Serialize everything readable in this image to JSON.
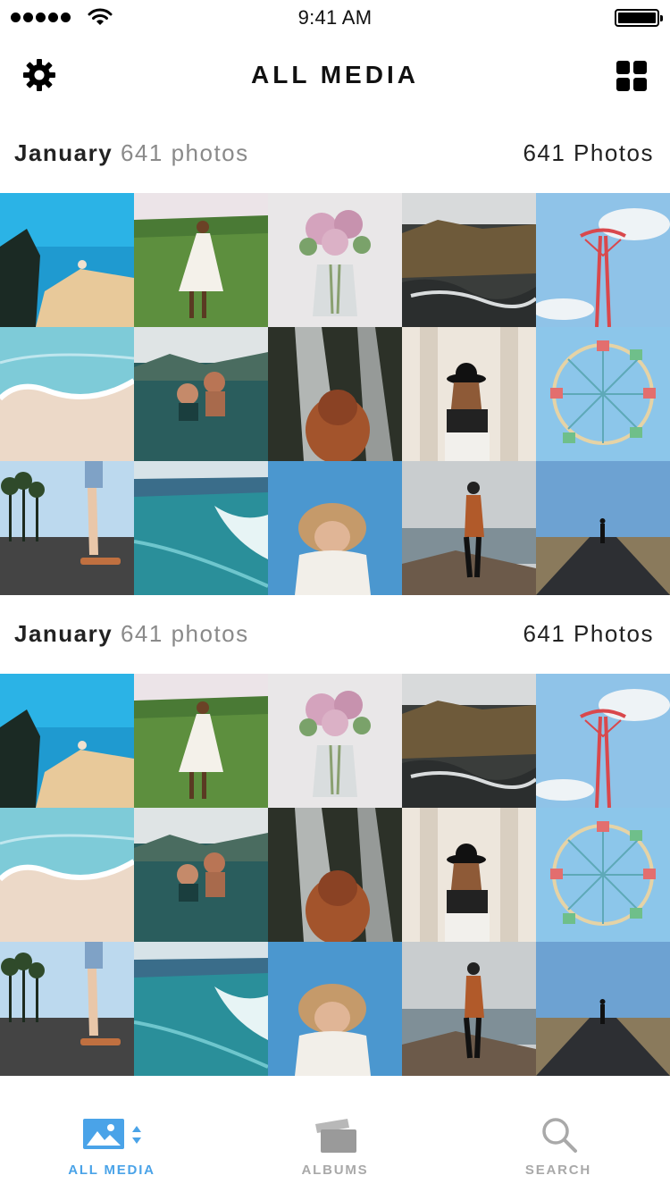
{
  "status_bar": {
    "time": "9:41 AM",
    "signal_icon": "signal-dots-icon",
    "wifi_icon": "wifi-icon",
    "battery_icon": "battery-icon"
  },
  "nav": {
    "title": "ALL MEDIA",
    "left_icon": "gear-icon",
    "right_icon": "grid-view-icon"
  },
  "sections": [
    {
      "month": "January",
      "count_label": "641 photos",
      "total_label": "641 Photos",
      "photos": [
        {
          "subject": "cliff-over-ocean"
        },
        {
          "subject": "girl-in-meadow"
        },
        {
          "subject": "rose-vase"
        },
        {
          "subject": "rocky-coast"
        },
        {
          "subject": "red-tower"
        },
        {
          "subject": "beach-waves"
        },
        {
          "subject": "snorkel-couple"
        },
        {
          "subject": "waterfall-girl"
        },
        {
          "subject": "girl-in-hat-hallway"
        },
        {
          "subject": "ferris-wheel"
        },
        {
          "subject": "skateboard-palms"
        },
        {
          "subject": "surf-ocean"
        },
        {
          "subject": "woman-straw-hat"
        },
        {
          "subject": "woman-on-rocks"
        },
        {
          "subject": "desert-road"
        }
      ]
    },
    {
      "month": "January",
      "count_label": "641 photos",
      "total_label": "641 Photos",
      "photos": [
        {
          "subject": "cliff-over-ocean"
        },
        {
          "subject": "girl-in-meadow"
        },
        {
          "subject": "rose-vase"
        },
        {
          "subject": "rocky-coast"
        },
        {
          "subject": "red-tower"
        },
        {
          "subject": "beach-waves"
        },
        {
          "subject": "snorkel-couple"
        },
        {
          "subject": "waterfall-girl"
        },
        {
          "subject": "girl-in-hat-hallway"
        },
        {
          "subject": "ferris-wheel"
        },
        {
          "subject": "skateboard-palms"
        },
        {
          "subject": "surf-ocean"
        },
        {
          "subject": "woman-straw-hat"
        },
        {
          "subject": "woman-on-rocks"
        },
        {
          "subject": "desert-road"
        }
      ]
    }
  ],
  "tabs": [
    {
      "label": "ALL MEDIA",
      "icon": "photo-icon",
      "active": true
    },
    {
      "label": "ALBUMS",
      "icon": "albums-icon",
      "active": false
    },
    {
      "label": "SEARCH",
      "icon": "search-icon",
      "active": false
    }
  ],
  "colors": {
    "accent": "#4aa3e8",
    "inactive": "#a9a9a9",
    "muted_text": "#8a8a8a"
  }
}
